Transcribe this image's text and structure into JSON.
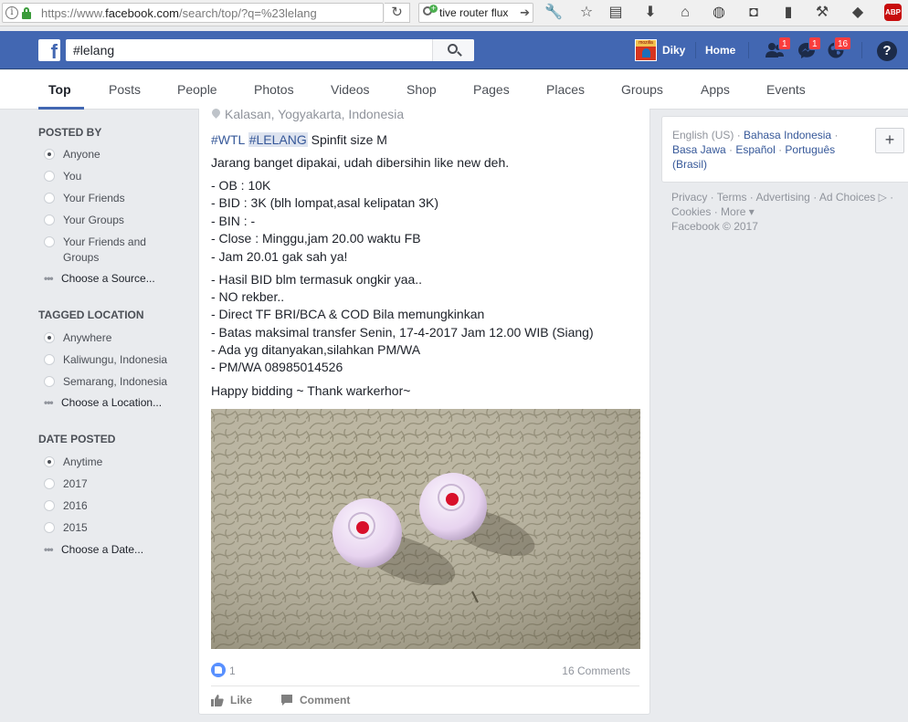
{
  "browser": {
    "url_prefix": "https://www.",
    "url_host": "facebook.com",
    "url_path": "/search/top/?q=%23lelang",
    "search_text": "tive router flux",
    "abp_label": "ABP"
  },
  "fb": {
    "logo": "f",
    "search_query": "#lelang",
    "profile_name": "Diky",
    "avatar_text": "mozilla",
    "home_label": "Home",
    "badges": {
      "friends": "1",
      "messages": "1",
      "notifications": "16"
    },
    "help": "?"
  },
  "tabs": [
    "Top",
    "Posts",
    "People",
    "Photos",
    "Videos",
    "Shop",
    "Pages",
    "Places",
    "Groups",
    "Apps",
    "Events"
  ],
  "filters": {
    "posted_by": {
      "title": "POSTED BY",
      "options": [
        "Anyone",
        "You",
        "Your Friends",
        "Your Groups",
        "Your Friends and",
        "Groups"
      ],
      "more": "Choose a Source..."
    },
    "tagged_location": {
      "title": "TAGGED LOCATION",
      "options": [
        "Anywhere",
        "Kaliwungu, Indonesia",
        "Semarang, Indonesia"
      ],
      "more": "Choose a Location..."
    },
    "date_posted": {
      "title": "DATE POSTED",
      "options": [
        "Anytime",
        "2017",
        "2016",
        "2015"
      ],
      "more": "Choose a Date..."
    }
  },
  "post": {
    "location": "Kalasan, Yogyakarta, Indonesia",
    "tag1": "#WTL",
    "tag2": "#LELANG",
    "title_rest": " Spinfit size M",
    "intro": "Jarang banget dipakai, udah dibersihin like new deh.",
    "block1": [
      "- OB : 10K",
      "- BID : 3K (blh lompat,asal kelipatan 3K)",
      "- BIN : -",
      "- Close : Minggu,jam 20.00 waktu FB",
      "- Jam 20.01 gak sah ya!"
    ],
    "block2": [
      "- Hasil BID blm termasuk ongkir yaa..",
      "- NO rekber..",
      "- Direct TF BRI/BCA & COD Bila memungkinkan",
      "- Batas maksimal transfer Senin, 17-4-2017 Jam 12.00 WIB (Siang)",
      "- Ada yg ditanyakan,silahkan PM/WA",
      "- PM/WA 08985014526"
    ],
    "closing": "Happy bidding ~ Thank warkerhor~",
    "reaction_count": "1",
    "comments": "16 Comments",
    "like_label": "Like",
    "comment_label": "Comment"
  },
  "right": {
    "lang_current": "English (US)",
    "lang_links": [
      "Bahasa Indonesia",
      "Basa Jawa",
      "Español",
      "Português (Brasil)"
    ],
    "plus": "+",
    "footer_links": [
      "Privacy",
      "Terms",
      "Advertising",
      "Ad Choices",
      "Cookies",
      "More"
    ],
    "copyright": "Facebook © 2017"
  },
  "colors": {
    "fb_blue": "#4267b2",
    "link": "#365899",
    "page_bg": "#e9ebee",
    "badge": "#fa3e3e"
  }
}
